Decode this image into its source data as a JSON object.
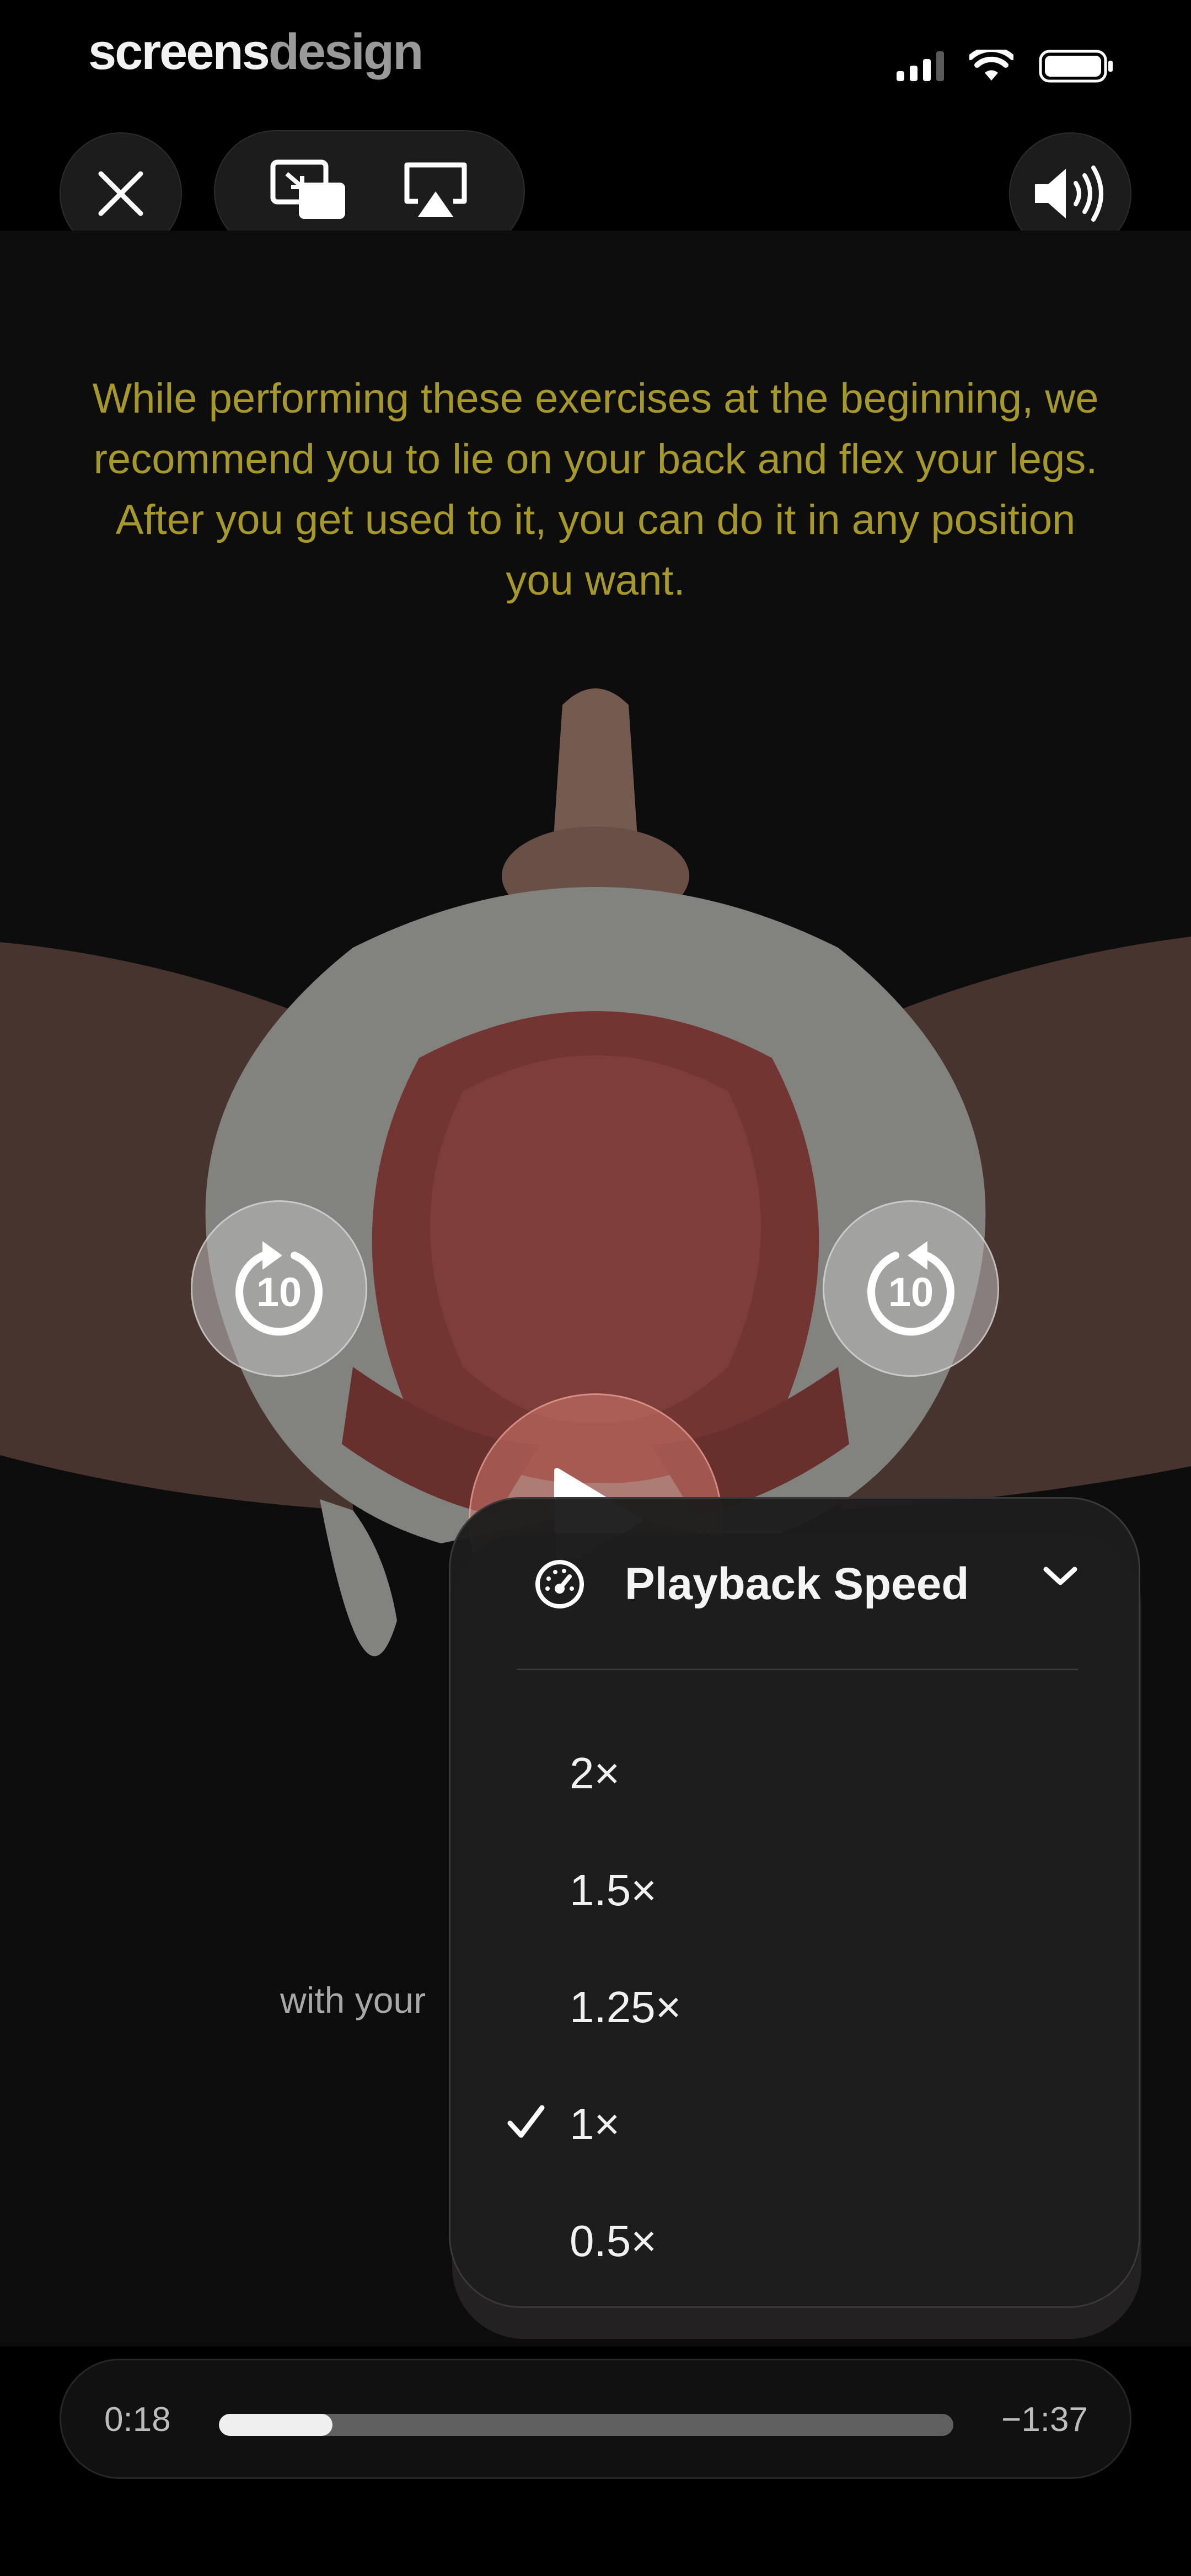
{
  "status_bar": {
    "brand_part1": "screens",
    "brand_part2": "design"
  },
  "video": {
    "instruction_text": "While performing these exercises at the beginning, we recommend you to lie on your back and flex your legs. After you get used to it, you can do it in any position you want.",
    "subtitle_visible": "with your",
    "accent_color": "#a7982a"
  },
  "controls": {
    "close_icon": "close-icon",
    "pip_icon": "picture-in-picture-icon",
    "airplay_icon": "airplay-icon",
    "volume_icon": "speaker-volume-icon",
    "skip_back_label": "10",
    "skip_forward_label": "10",
    "play_icon": "play-icon"
  },
  "speed_menu": {
    "title": "Playback Speed",
    "options": [
      {
        "label": "2×",
        "selected": false
      },
      {
        "label": "1.5×",
        "selected": false
      },
      {
        "label": "1.25×",
        "selected": false
      },
      {
        "label": "1×",
        "selected": true
      },
      {
        "label": "0.5×",
        "selected": false
      }
    ]
  },
  "scrubber": {
    "current_time": "0:18",
    "remaining_time": "−1:37",
    "progress_fraction": 0.155
  }
}
